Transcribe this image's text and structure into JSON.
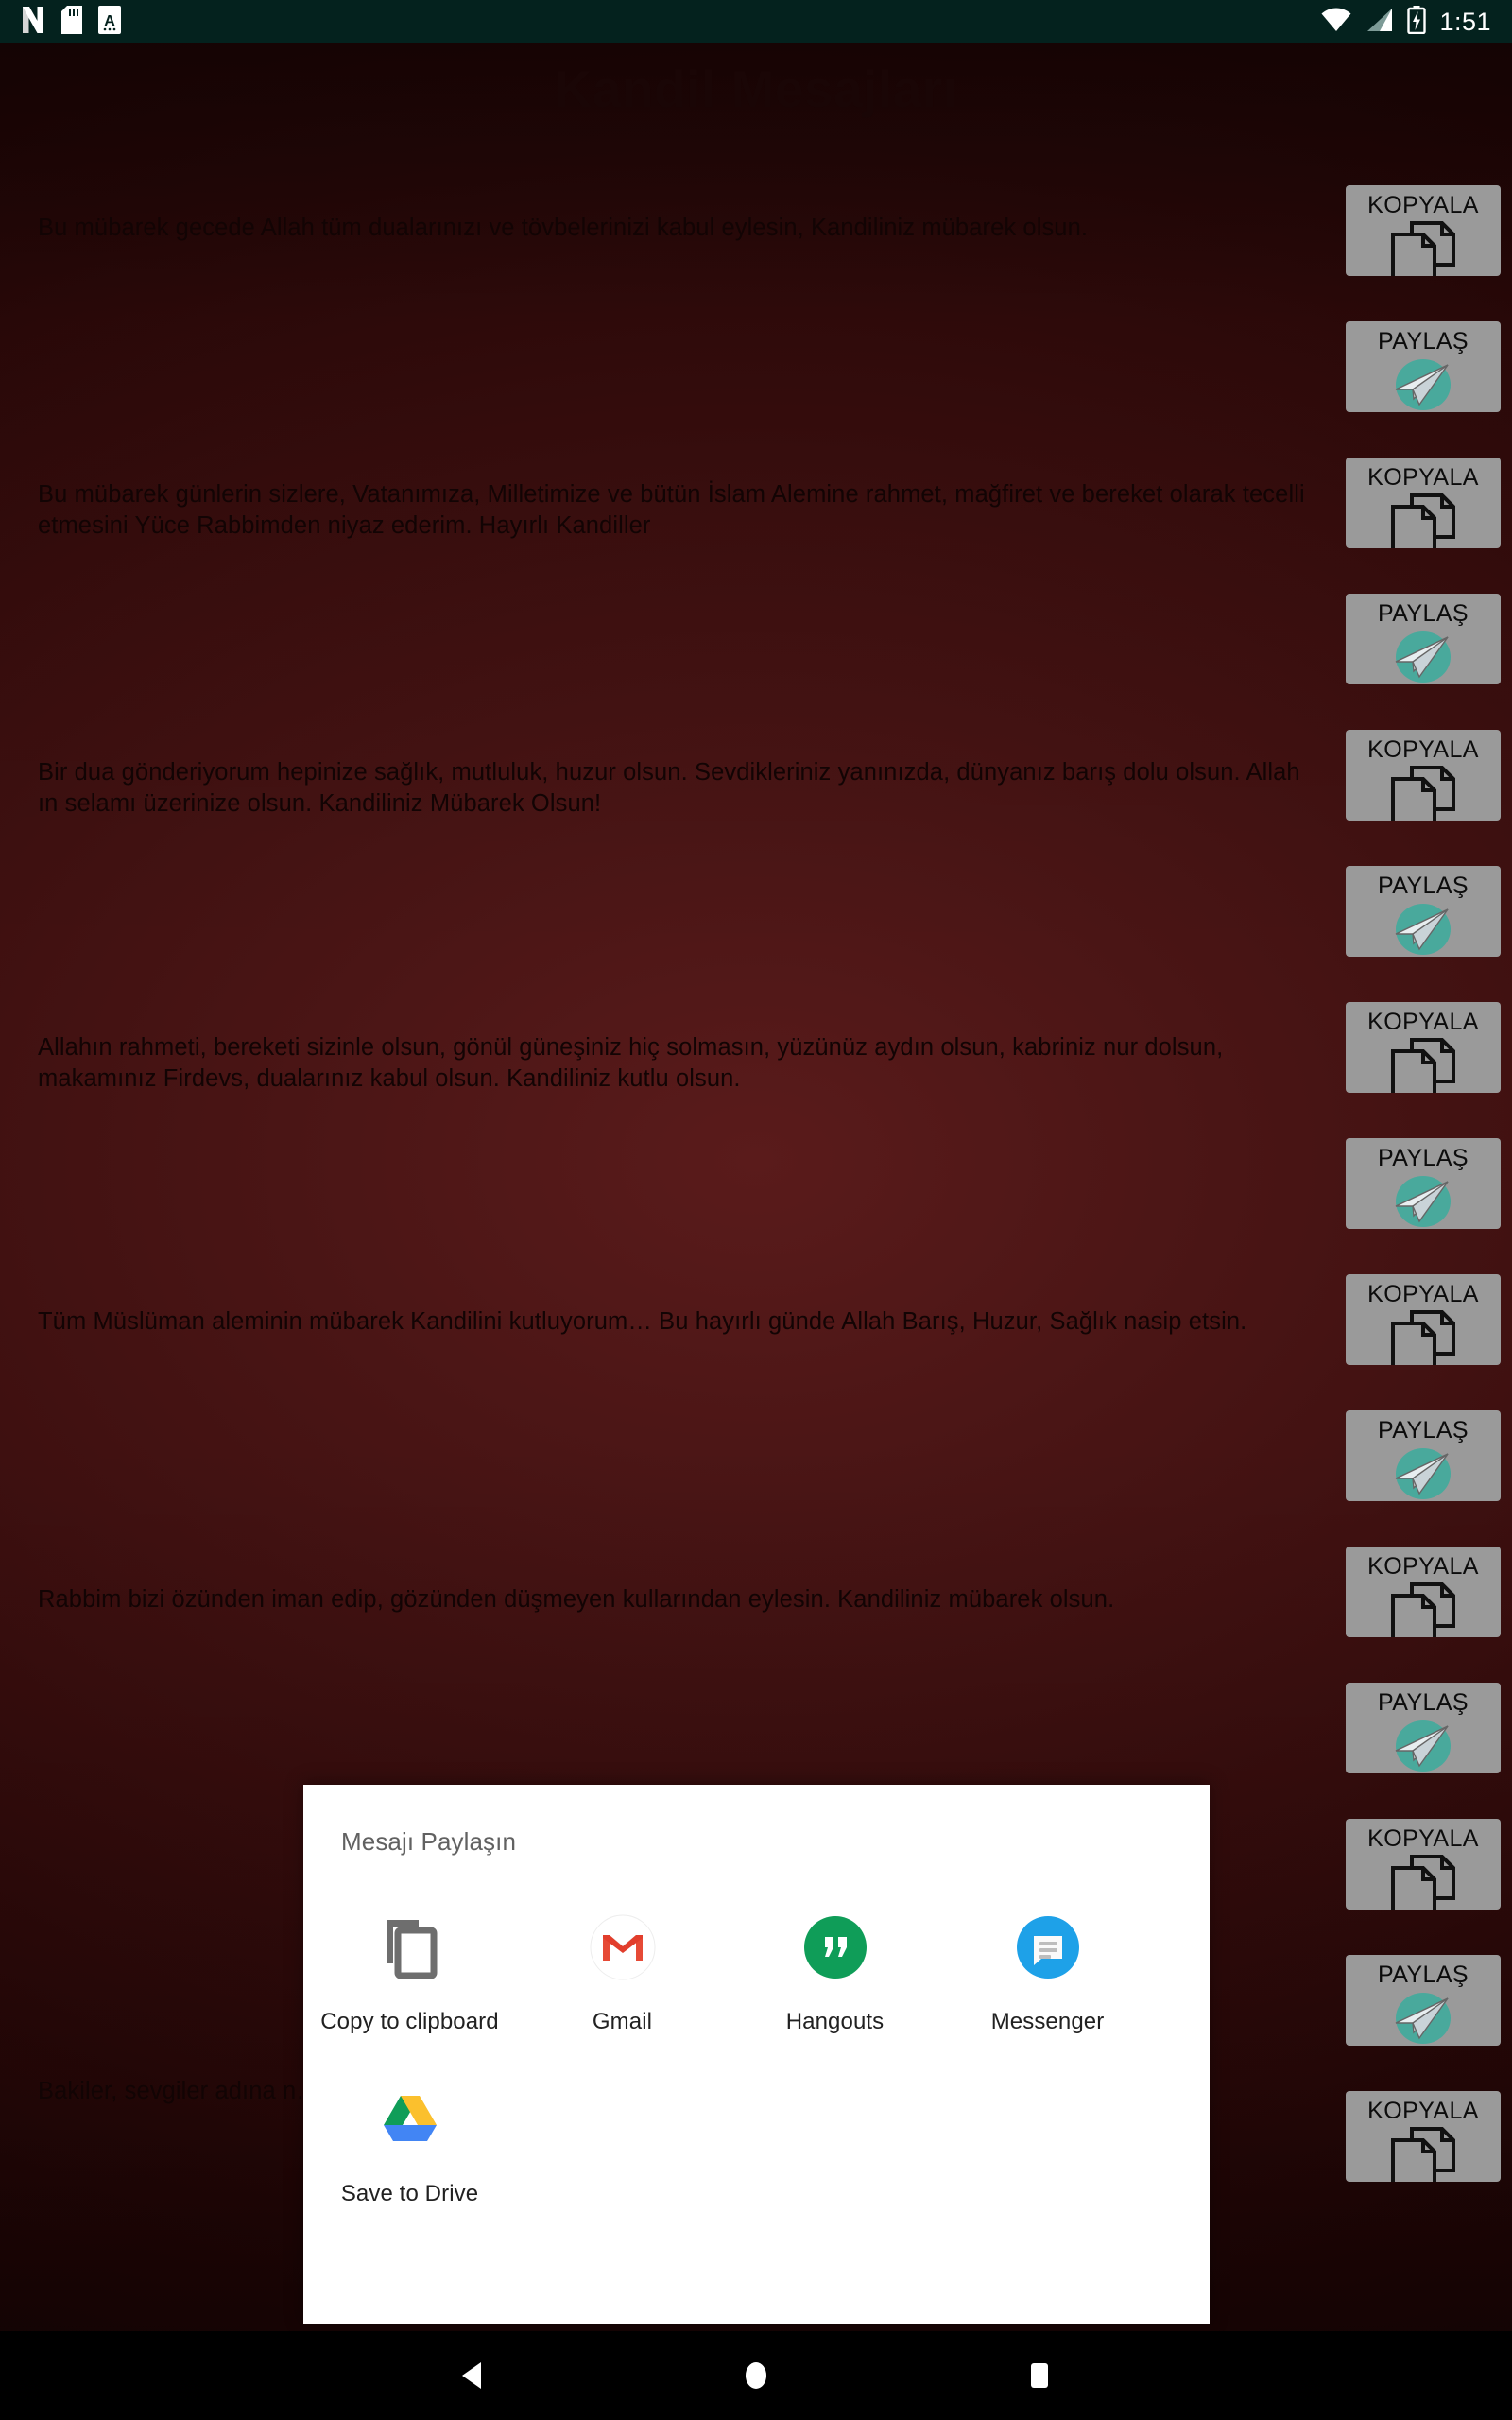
{
  "statusbar": {
    "time": "1:51",
    "left_icons": [
      "netflix-icon",
      "sd-card-icon",
      "letter-a-icon"
    ],
    "right_icons": [
      "wifi-icon",
      "cell-signal-icon",
      "battery-charging-icon"
    ]
  },
  "app": {
    "title": "Kandil Mesajları",
    "bg_color": "#4a1515",
    "title_color": "#1a0606"
  },
  "messages": [
    {
      "text": "Bu mübarek gecede Allah tüm dualarınızı ve tövbelerinizi kabul eylesin, Kandiliniz mübarek olsun."
    },
    {
      "text": "Bu mübarek günlerin sizlere, Vatanımıza, Milletimize ve bütün İslam Alemine rahmet, mağfiret ve bereket olarak tecelli etmesini Yüce Rabbimden niyaz ederim. Hayırlı Kandiller"
    },
    {
      "text": "Bir dua gönderiyorum hepinize sağlık, mutluluk, huzur olsun. Sevdikleriniz yanınızda, dünyanız barış dolu olsun. Allah ın selamı üzerinize olsun. Kandiliniz Mübarek Olsun!"
    },
    {
      "text": "Allahın rahmeti, bereketi sizinle olsun, gönül güneşiniz hiç solmasın, yüzünüz aydın olsun, kabriniz nur dolsun, makamınız Firdevs, dualarınız kabul olsun. Kandiliniz kutlu olsun."
    },
    {
      "text": "Tüm Müslüman aleminin mübarek Kandilini kutluyorum… Bu hayırlı günde Allah Barış, Huzur, Sağlık nasip etsin."
    },
    {
      "text": "Rabbim bizi özünden iman edip, gözünden düşmeyen kullarından eylesin. Kandiliniz mübarek olsun."
    },
    {
      "text": "Bakiler, sevgiler adına n… set çekmişse ne çıkar, dua…"
    }
  ],
  "side_buttons": {
    "copy_label": "KOPYALA",
    "share_label": "PAYLAŞ",
    "bg_color": "#9a9a9a",
    "items": [
      "KOPYALA",
      "PAYLAŞ",
      "KOPYALA",
      "PAYLAŞ",
      "KOPYALA",
      "PAYLAŞ",
      "KOPYALA",
      "PAYLAŞ",
      "KOPYALA",
      "PAYLAŞ",
      "KOPYALA",
      "PAYLAŞ",
      "KOPYALA",
      "PAYLAŞ",
      "KOPYALA"
    ]
  },
  "share_dialog": {
    "title": "Mesajı Paylaşın",
    "targets": [
      {
        "label": "Copy to clipboard",
        "icon": "copy-to-clipboard-icon"
      },
      {
        "label": "Gmail",
        "icon": "gmail-icon"
      },
      {
        "label": "Hangouts",
        "icon": "hangouts-icon"
      },
      {
        "label": "Messenger",
        "icon": "messenger-icon"
      },
      {
        "label": "Save to Drive",
        "icon": "google-drive-icon"
      }
    ]
  },
  "navbar": {
    "back": "back-button",
    "home": "home-button",
    "recents": "recents-button"
  }
}
